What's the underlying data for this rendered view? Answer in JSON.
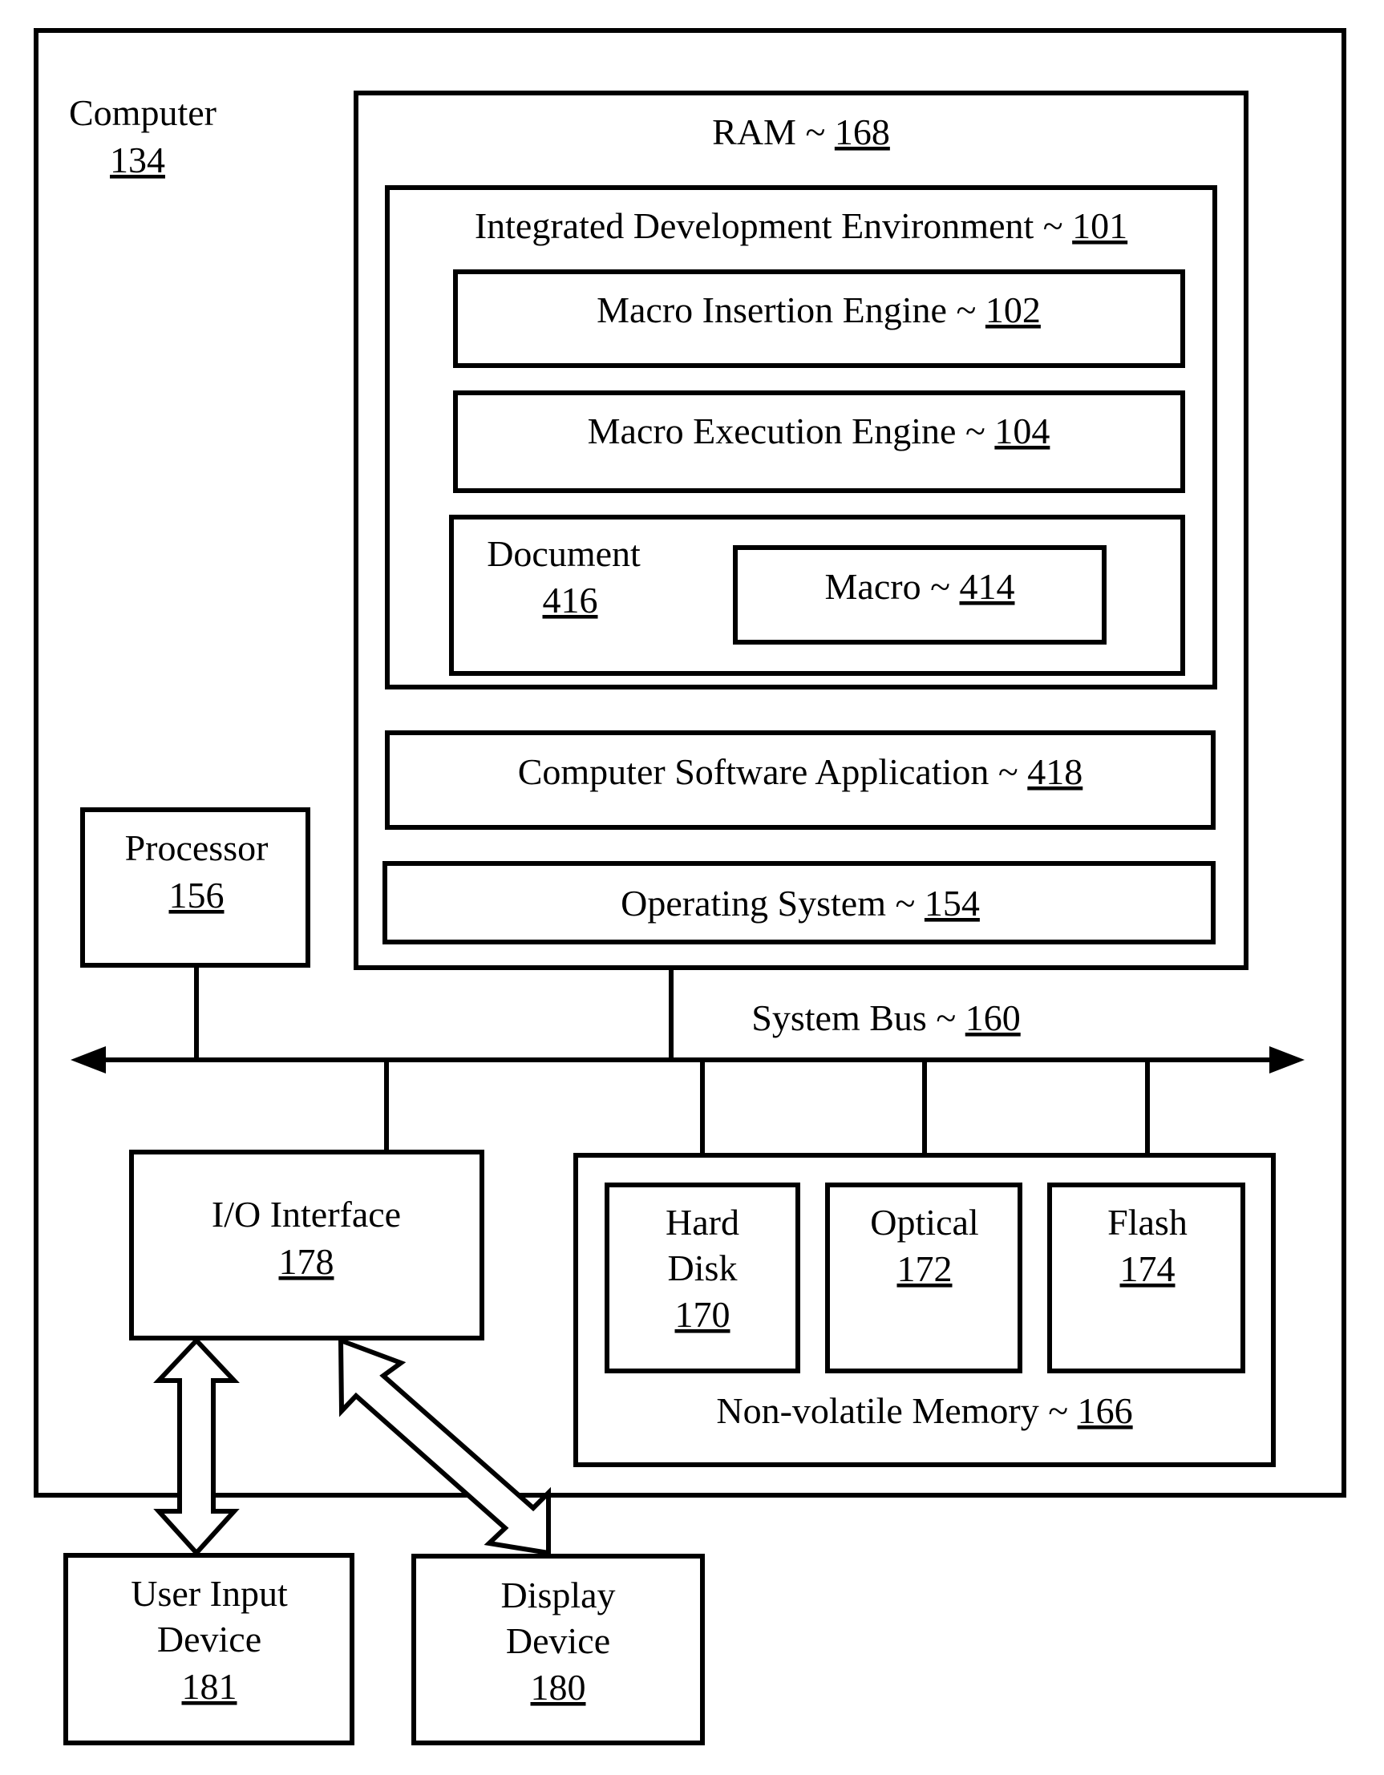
{
  "diagram": {
    "computer": {
      "label": "Computer",
      "ref": "134"
    },
    "ram": {
      "label": "RAM ~ ",
      "ref": "168"
    },
    "ide": {
      "label": "Integrated Development Environment ~ ",
      "ref": "101"
    },
    "macro_insertion_engine": {
      "label": "Macro Insertion Engine ~ ",
      "ref": "102"
    },
    "macro_execution_engine": {
      "label": "Macro Execution Engine ~ ",
      "ref": "104"
    },
    "document": {
      "label": "Document",
      "ref": "416"
    },
    "macro": {
      "label": "Macro ~ ",
      "ref": "414"
    },
    "software_application": {
      "label": "Computer Software Application ~ ",
      "ref": "418"
    },
    "operating_system": {
      "label": "Operating System ~ ",
      "ref": "154"
    },
    "processor": {
      "label": "Processor",
      "ref": "156"
    },
    "system_bus": {
      "label": "System Bus ~ ",
      "ref": "160"
    },
    "io_interface": {
      "label": "I/O Interface",
      "ref": "178"
    },
    "non_volatile_memory": {
      "label": "Non-volatile Memory ~ ",
      "ref": "166"
    },
    "hard_disk": {
      "line1": "Hard",
      "line2": "Disk",
      "ref": "170"
    },
    "optical": {
      "label": "Optical",
      "ref": "172"
    },
    "flash": {
      "label": "Flash",
      "ref": "174"
    },
    "user_input_device": {
      "line1": "User Input",
      "line2": "Device",
      "ref": "181"
    },
    "display_device": {
      "line1": "Display",
      "line2": "Device",
      "ref": "180"
    }
  }
}
